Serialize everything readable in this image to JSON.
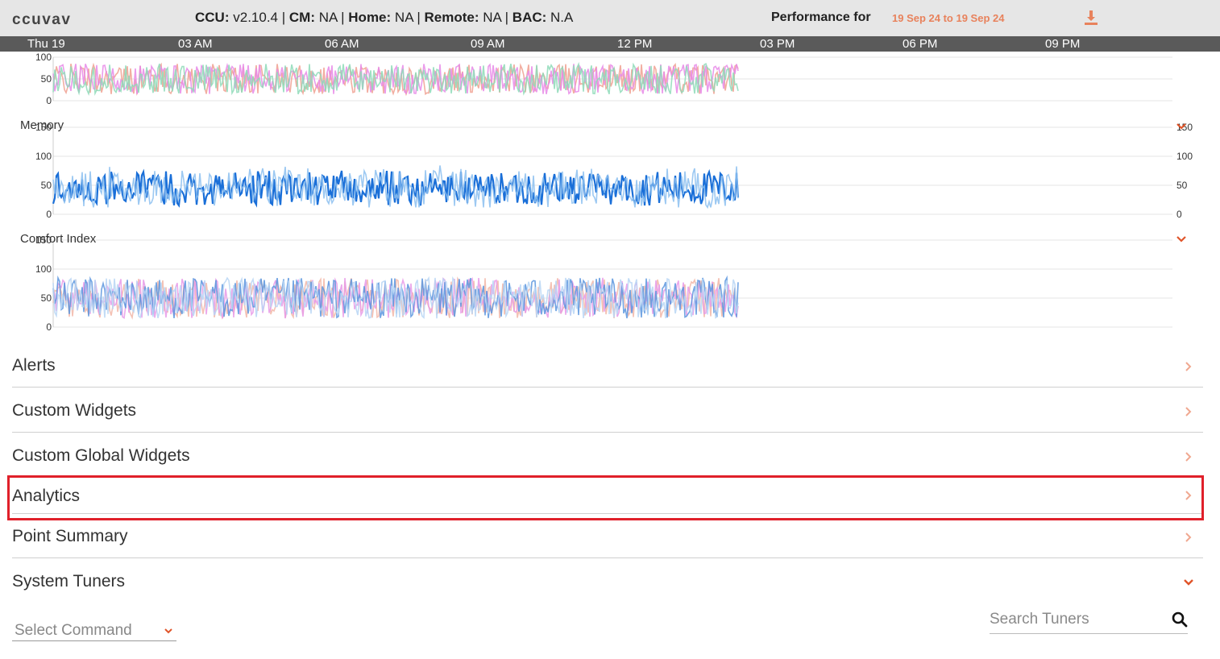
{
  "header": {
    "site_name": "ccuvav",
    "ccu_label": "CCU:",
    "ccu_value": "v2.10.4",
    "cm_label": "CM:",
    "cm_value": "NA",
    "home_label": "Home:",
    "home_value": "NA",
    "remote_label": "Remote:",
    "remote_value": "NA",
    "bac_label": "BAC:",
    "bac_value": "N.A",
    "performance_label": "Performance for",
    "performance_range": "19 Sep 24 to 19 Sep 24",
    "download_icon": "download-icon",
    "accent_color": "#e8825c"
  },
  "time_axis": {
    "ticks": [
      "Thu 19",
      "03 AM",
      "06 AM",
      "09 AM",
      "12 PM",
      "03 PM",
      "06 PM",
      "09 PM"
    ]
  },
  "chart_data": [
    {
      "type": "line",
      "title": "",
      "x_range": [
        "Thu 19",
        "09 PM"
      ],
      "data_end": "02 PM",
      "yticks": [
        "100",
        "50",
        "0"
      ],
      "ylim": [
        0,
        100
      ],
      "series_colors": [
        "#f0a090",
        "#e88ae8",
        "#8edbb8"
      ]
    },
    {
      "type": "line",
      "title": "Memory",
      "yticks": [
        "150",
        "100",
        "50",
        "0"
      ],
      "yticks_right": [
        "150",
        "100",
        "50",
        "0"
      ],
      "ylim": [
        0,
        150
      ],
      "series_colors": [
        "#1a6fd8",
        "#8cc0f0"
      ]
    },
    {
      "type": "line",
      "title": "Comfort Index",
      "yticks": [
        "150",
        "100",
        "50",
        "0"
      ],
      "ylim": [
        0,
        150
      ],
      "series_colors": [
        "#f2b7a8",
        "#e89ae8",
        "#5a95de",
        "#b9d6f5"
      ]
    }
  ],
  "sections": [
    {
      "label": "Alerts",
      "state": "collapsed"
    },
    {
      "label": "Custom Widgets",
      "state": "collapsed"
    },
    {
      "label": "Custom Global Widgets",
      "state": "collapsed"
    },
    {
      "label": "Analytics",
      "state": "collapsed"
    },
    {
      "label": "Point Summary",
      "state": "collapsed"
    },
    {
      "label": "System Tuners",
      "state": "expanded"
    }
  ],
  "tuners": {
    "select_command": "Select Command",
    "search_placeholder": "Search Tuners"
  }
}
